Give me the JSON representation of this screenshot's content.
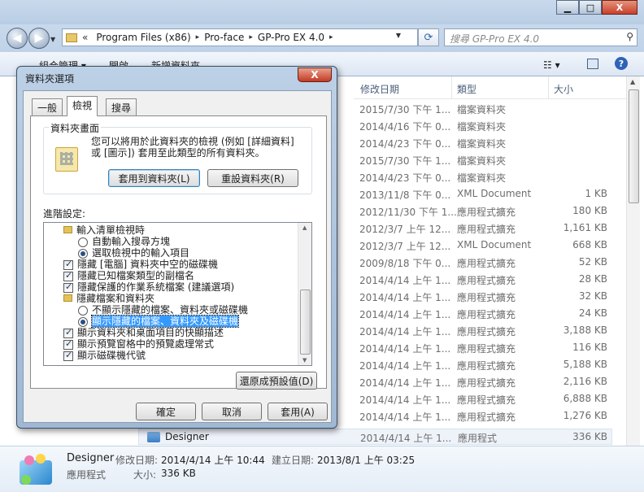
{
  "window": {
    "controls": {
      "minimize": "▁",
      "maximize": "□",
      "close": "X"
    }
  },
  "address": {
    "overflow": "«",
    "segments": [
      "Program Files (x86)",
      "Pro-face",
      "GP-Pro EX 4.0"
    ],
    "separator": "▸"
  },
  "search": {
    "placeholder": "搜尋 GP-Pro EX 4.0"
  },
  "toolbar": {
    "organize": "組合管理 ▾",
    "open": "開啟",
    "new_folder": "新增資料夾"
  },
  "file_list": {
    "columns": {
      "date": "修改日期",
      "type": "類型",
      "size": "大小"
    },
    "rows": [
      {
        "date": "2015/7/30 下午 1...",
        "type": "檔案資料夾",
        "size": ""
      },
      {
        "date": "2014/4/16 下午 0...",
        "type": "檔案資料夾",
        "size": ""
      },
      {
        "date": "2014/4/23 下午 0...",
        "type": "檔案資料夾",
        "size": ""
      },
      {
        "date": "2015/7/30 下午 1...",
        "type": "檔案資料夾",
        "size": ""
      },
      {
        "date": "2014/4/23 下午 0...",
        "type": "檔案資料夾",
        "size": ""
      },
      {
        "date": "2013/11/8 下午 0...",
        "type": "XML Document",
        "size": "1 KB"
      },
      {
        "date": "2012/11/30 下午 1...",
        "type": "應用程式擴充",
        "size": "180 KB"
      },
      {
        "date": "2012/3/7 上午 12...",
        "type": "應用程式擴充",
        "size": "1,161 KB"
      },
      {
        "date": "2012/3/7 上午 12...",
        "type": "XML Document",
        "size": "668 KB"
      },
      {
        "date": "2009/8/18 下午 0...",
        "type": "應用程式擴充",
        "size": "52 KB"
      },
      {
        "date": "2014/4/14 上午 1...",
        "type": "應用程式擴充",
        "size": "28 KB"
      },
      {
        "date": "2014/4/14 上午 1...",
        "type": "應用程式擴充",
        "size": "32 KB"
      },
      {
        "date": "2014/4/14 上午 1...",
        "type": "應用程式擴充",
        "size": "24 KB"
      },
      {
        "date": "2014/4/14 上午 1...",
        "type": "應用程式擴充",
        "size": "3,188 KB"
      },
      {
        "date": "2014/4/14 上午 1...",
        "type": "應用程式擴充",
        "size": "116 KB"
      },
      {
        "date": "2014/4/14 上午 1...",
        "type": "應用程式擴充",
        "size": "5,188 KB"
      },
      {
        "date": "2014/4/14 上午 1...",
        "type": "應用程式擴充",
        "size": "2,116 KB"
      },
      {
        "date": "2014/4/14 上午 1...",
        "type": "應用程式擴充",
        "size": "6,888 KB"
      },
      {
        "date": "2014/4/14 上午 1...",
        "type": "應用程式擴充",
        "size": "1,276 KB"
      }
    ],
    "selected": {
      "name": "Designer",
      "date": "2014/4/14 上午 1...",
      "type": "應用程式",
      "size": "336 KB"
    }
  },
  "details": {
    "name": "Designer",
    "modified_label": "修改日期:",
    "modified_value": "2014/4/14 上午 10:44",
    "created_label": "建立日期:",
    "created_value": "2013/8/1 上午 03:25",
    "type": "應用程式",
    "size_label": "大小:",
    "size_value": "336 KB"
  },
  "dialog": {
    "title": "資料夾選項",
    "close": "X",
    "tabs": [
      "一般",
      "檢視",
      "搜尋"
    ],
    "group_title": "資料夾畫面",
    "group_text": "您可以將用於此資料夾的檢視 (例如 [詳細資料] 或 [圖示]) 套用至此類型的所有資料夾。",
    "apply_to_folders": "套用到資料夾(L)",
    "reset_folders": "重設資料夾(R)",
    "advanced_label": "進階設定:",
    "tree": [
      {
        "kind": "folder",
        "indent": 0,
        "label": "輸入清單檢視時"
      },
      {
        "kind": "radio",
        "indent": 1,
        "label": "自動輸入搜尋方塊",
        "on": false
      },
      {
        "kind": "radio",
        "indent": 1,
        "label": "選取檢視中的輸入項目",
        "on": true
      },
      {
        "kind": "check",
        "indent": 0,
        "label": "隱藏 [電腦] 資料夾中空的磁碟機"
      },
      {
        "kind": "check",
        "indent": 0,
        "label": "隱藏已知檔案類型的副檔名"
      },
      {
        "kind": "check",
        "indent": 0,
        "label": "隱藏保護的作業系統檔案 (建議選項)"
      },
      {
        "kind": "folder",
        "indent": 0,
        "label": "隱藏檔案和資料夾"
      },
      {
        "kind": "radio",
        "indent": 1,
        "label": "不顯示隱藏的檔案、資料夾或磁碟機",
        "on": false
      },
      {
        "kind": "radio",
        "indent": 1,
        "label": "顯示隱藏的檔案、資料夾及磁碟機",
        "on": true,
        "selected": true
      },
      {
        "kind": "check",
        "indent": 0,
        "label": "顯示資料夾和桌面項目的快顯描述"
      },
      {
        "kind": "check",
        "indent": 0,
        "label": "顯示預覽窗格中的預覽處理常式"
      },
      {
        "kind": "check",
        "indent": 0,
        "label": "顯示磁碟機代號"
      }
    ],
    "restore_defaults": "還原成預設值(D)",
    "ok": "確定",
    "cancel": "取消",
    "apply": "套用(A)"
  }
}
